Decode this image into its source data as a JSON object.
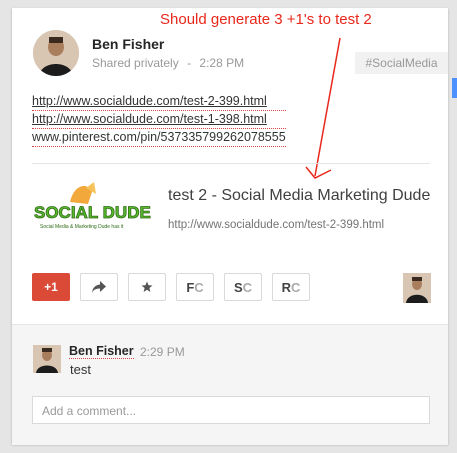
{
  "annotation": {
    "text": "Should generate 3 +1's to test 2"
  },
  "post": {
    "author": "Ben Fisher",
    "visibility": "Shared privately",
    "separator": "-",
    "time": "2:28 PM",
    "hashtag": "#SocialMedia",
    "links": [
      "http://www.socialdude.com/test-2-399.html",
      "http://www.socialdude.com/test-1-398.html",
      "www.pinterest.com/pin/537335799262078555"
    ],
    "preview": {
      "logo_text": "SOCIAL DUDE",
      "logo_subtext": "Social Media & Marketing Dude has it",
      "title": "test 2 - Social Media Marketing Dude",
      "url": "http://www.socialdude.com/test-2-399.html"
    }
  },
  "actions": {
    "plus_one": "+1",
    "fc": {
      "a": "F",
      "b": "C"
    },
    "sc": {
      "a": "S",
      "b": "C"
    },
    "rc": {
      "a": "R",
      "b": "C"
    }
  },
  "comment": {
    "author": "Ben Fisher",
    "time": "2:29 PM",
    "text": "test",
    "input_placeholder": "Add a comment..."
  },
  "colors": {
    "plus_one_red": "#db4a37",
    "annotation_red": "#e8281d",
    "accent_blue": "#4d90fe"
  }
}
